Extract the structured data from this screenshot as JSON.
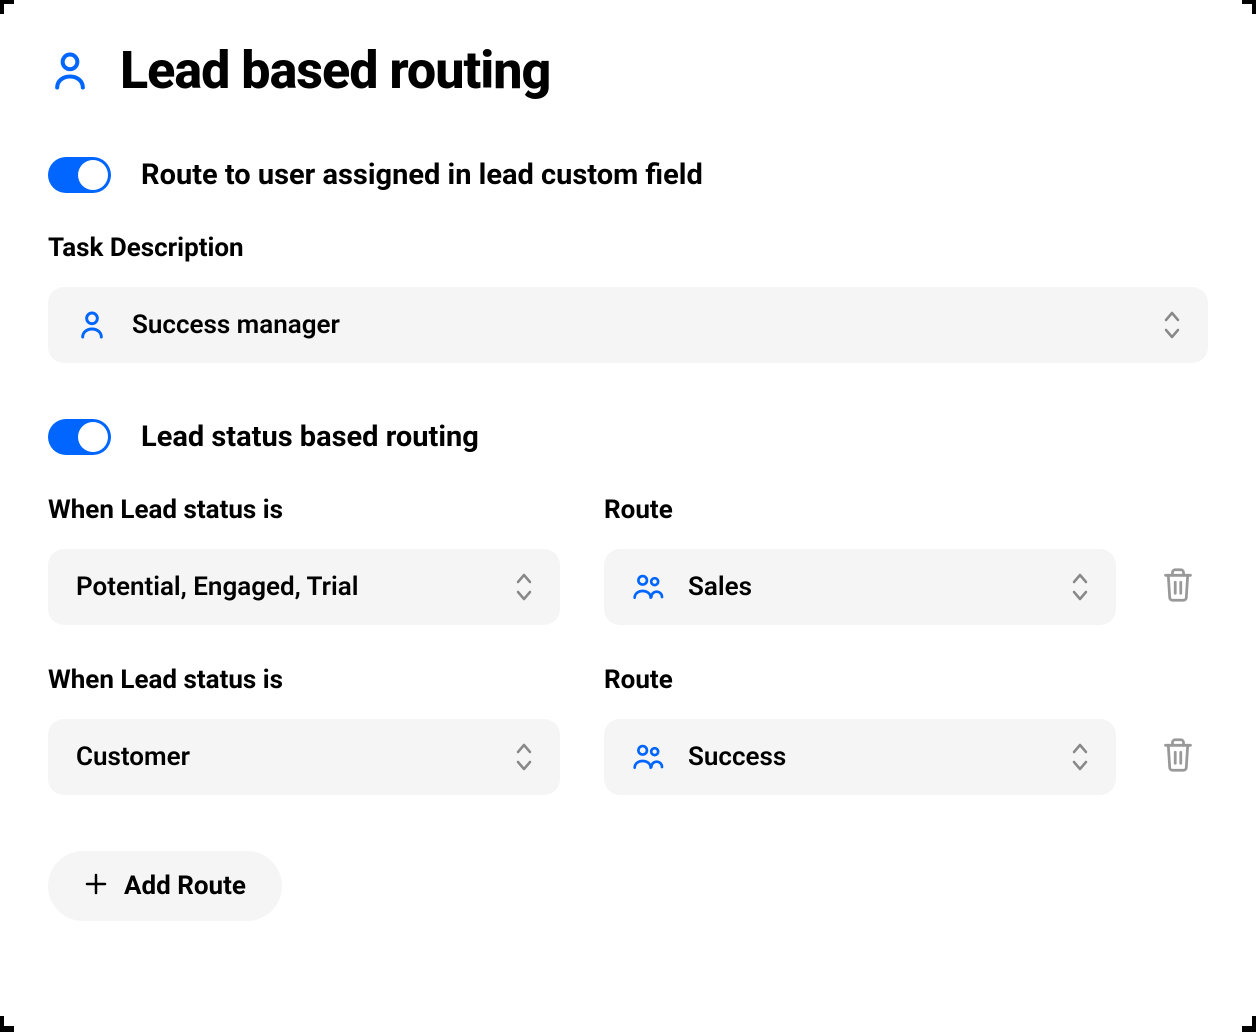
{
  "header": {
    "title": "Lead based routing"
  },
  "toggle1": {
    "label": "Route to user assigned in lead custom field",
    "enabled": true
  },
  "task_description": {
    "label": "Task Description",
    "value": "Success manager"
  },
  "toggle2": {
    "label": "Lead status based routing",
    "enabled": true
  },
  "routes": [
    {
      "when_label": "When Lead status is",
      "when_value": "Potential, Engaged, Trial",
      "route_label": "Route",
      "route_value": "Sales"
    },
    {
      "when_label": "When Lead status is",
      "when_value": "Customer",
      "route_label": "Route",
      "route_value": "Success"
    }
  ],
  "add_route": {
    "label": "Add Route"
  }
}
